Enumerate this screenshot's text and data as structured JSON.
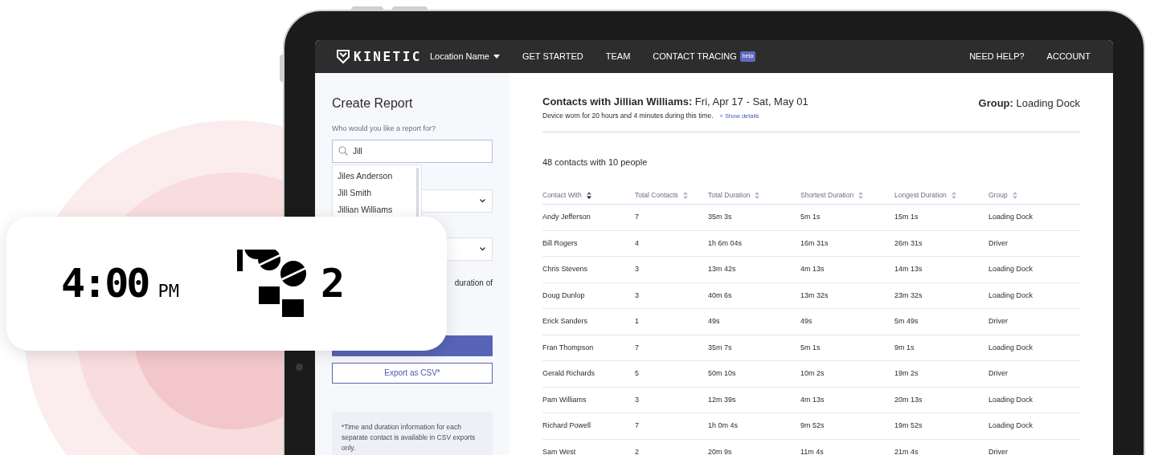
{
  "nav": {
    "logo": "KINETIC",
    "location": "Location Name",
    "links": [
      {
        "label": "GET STARTED"
      },
      {
        "label": "TEAM"
      },
      {
        "label": "CONTACT TRACING",
        "badge": "beta"
      }
    ],
    "right_links": [
      "NEED HELP?",
      "ACCOUNT"
    ]
  },
  "sidebar": {
    "title": "Create Report",
    "search_label": "Who would you like a report for?",
    "search_value": "Jill",
    "suggestions": [
      "Jiles Anderson",
      "Jill Smith",
      "Jillian Williams"
    ],
    "text_fragment": "duration of",
    "export_button": "Export as CSV*",
    "note": "*Time and duration information for each separate contact is available in CSV exports only."
  },
  "header": {
    "title": "**Contacts with Jillian Williams:** Fri, Apr 17 - Sat, May 01",
    "device_note": "Device worn for 20 hours and 4 minutes during this time.",
    "details_link": "+ Show details",
    "group": "**Group:** Loading Dock"
  },
  "summary": "48 contacts with 10 people",
  "table": {
    "columns": [
      {
        "label": "Contact With",
        "sorted": true
      },
      {
        "label": "Total Contacts",
        "sorted": false
      },
      {
        "label": "Total Duration",
        "sorted": false
      },
      {
        "label": "Shortest Duration",
        "sorted": false
      },
      {
        "label": "Longest Duration",
        "sorted": false
      },
      {
        "label": "Group",
        "sorted": false
      }
    ],
    "rows": [
      [
        "Andy Jefferson",
        "7",
        "35m 3s",
        "5m 1s",
        "15m 1s",
        "Loading Dock"
      ],
      [
        "Bill Rogers",
        "4",
        "1h 6m 04s",
        "16m 31s",
        "26m 31s",
        "Driver"
      ],
      [
        "Chris Stevens",
        "3",
        "13m 42s",
        "4m 13s",
        "14m 13s",
        "Loading Dock"
      ],
      [
        "Doug Dunlop",
        "3",
        "40m 6s",
        "13m 32s",
        "23m 32s",
        "Loading Dock"
      ],
      [
        "Erick Sanders",
        "1",
        "49s",
        "49s",
        "5m 49s",
        "Driver"
      ],
      [
        "Fran Thompson",
        "7",
        "35m 7s",
        "5m 1s",
        "9m 1s",
        "Loading Dock"
      ],
      [
        "Gerald Richards",
        "5",
        "50m 10s",
        "10m 2s",
        "19m 2s",
        "Driver"
      ],
      [
        "Pam Williams",
        "3",
        "12m 39s",
        "4m 13s",
        "20m 13s",
        "Loading Dock"
      ],
      [
        "Richard Powell",
        "7",
        "1h 0m 4s",
        "9m 52s",
        "19m 52s",
        "Loading Dock"
      ],
      [
        "Sam West",
        "2",
        "20m 9s",
        "11m 4s",
        "21m 4s",
        "Driver"
      ]
    ]
  },
  "overlay_card": {
    "time": "4:00",
    "meridiem": "PM",
    "count": "2"
  }
}
